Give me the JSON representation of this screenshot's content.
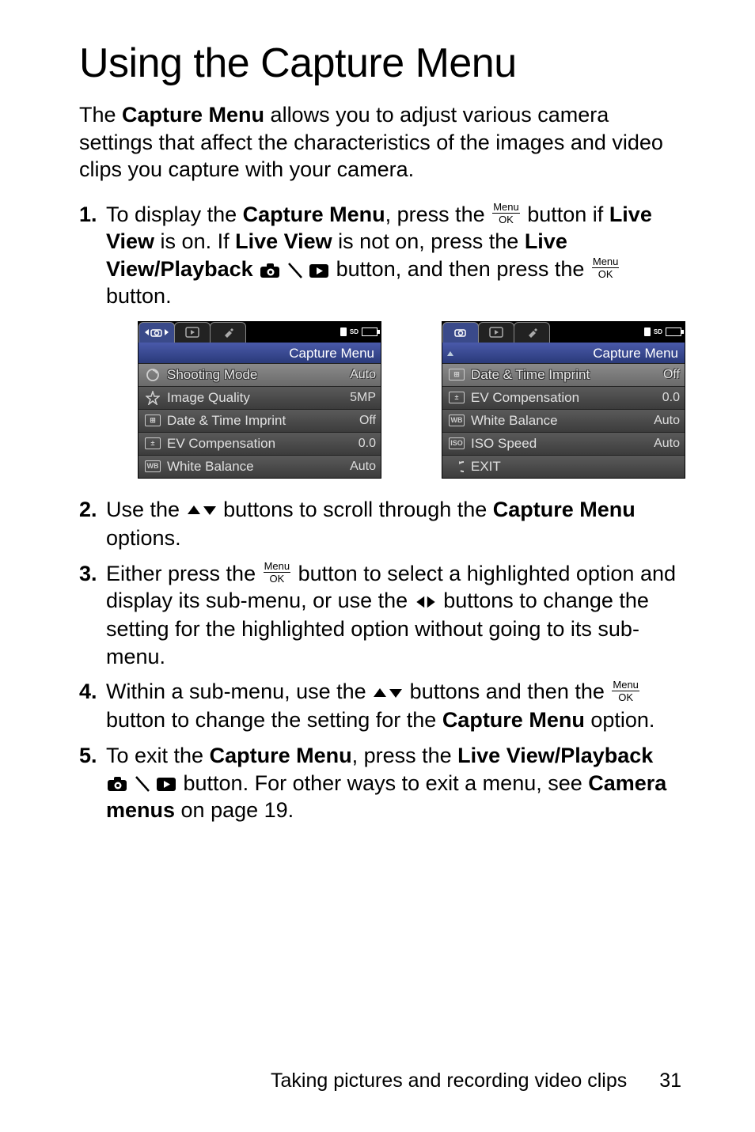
{
  "title": "Using the Capture Menu",
  "intro": {
    "p1a": "The ",
    "p1b": "Capture Menu",
    "p1c": " allows you to adjust various camera settings that affect the characteristics of the images and video clips you capture with your camera."
  },
  "steps": {
    "s1": {
      "a": "To display the ",
      "b": "Capture Menu",
      "c": ", press the ",
      "d": " button if ",
      "e": "Live View",
      "f": " is on. If ",
      "g": "Live View",
      "h": " is not on, press the ",
      "i": "Live View/Playback",
      "j": " button, and then press the ",
      "k": " button."
    },
    "s2": {
      "a": "Use the ",
      "b": " buttons to scroll through the ",
      "c": "Capture Menu",
      "d": " options."
    },
    "s3": {
      "a": "Either press the ",
      "b": " button to select a highlighted option and display its sub-menu, or use the ",
      "c": " buttons to change the setting for the highlighted option without going to its sub-menu."
    },
    "s4": {
      "a": "Within a sub-menu, use the ",
      "b": " buttons and then the ",
      "c": " button to change the setting for the ",
      "d": "Capture Menu",
      "e": " option."
    },
    "s5": {
      "a": "To exit the ",
      "b": "Capture Menu",
      "c": ", press the ",
      "d": "Live View/Playback",
      "e": " button. For other ways to exit a menu, see ",
      "f": "Camera menus",
      "g": " on page 19."
    }
  },
  "menu_ok": {
    "top": "Menu",
    "bot": "OK"
  },
  "screenshots": {
    "title": "Capture Menu",
    "sd": "SD",
    "s1": {
      "rows": [
        {
          "label": "Shooting Mode",
          "val": "Auto",
          "hl": true
        },
        {
          "label": "Image Quality",
          "val": "5MP"
        },
        {
          "label": "Date & Time Imprint",
          "val": "Off"
        },
        {
          "label": "EV Compensation",
          "val": "0.0"
        },
        {
          "label": "White Balance",
          "val": "Auto"
        }
      ]
    },
    "s2": {
      "rows": [
        {
          "label": "Date & Time Imprint",
          "val": "Off",
          "hl": true
        },
        {
          "label": "EV Compensation",
          "val": "0.0"
        },
        {
          "label": "White Balance",
          "val": "Auto"
        },
        {
          "label": "ISO Speed",
          "val": "Auto"
        },
        {
          "label": "EXIT",
          "val": ""
        }
      ]
    }
  },
  "footer": {
    "text": "Taking pictures and recording video clips",
    "page": "31"
  }
}
